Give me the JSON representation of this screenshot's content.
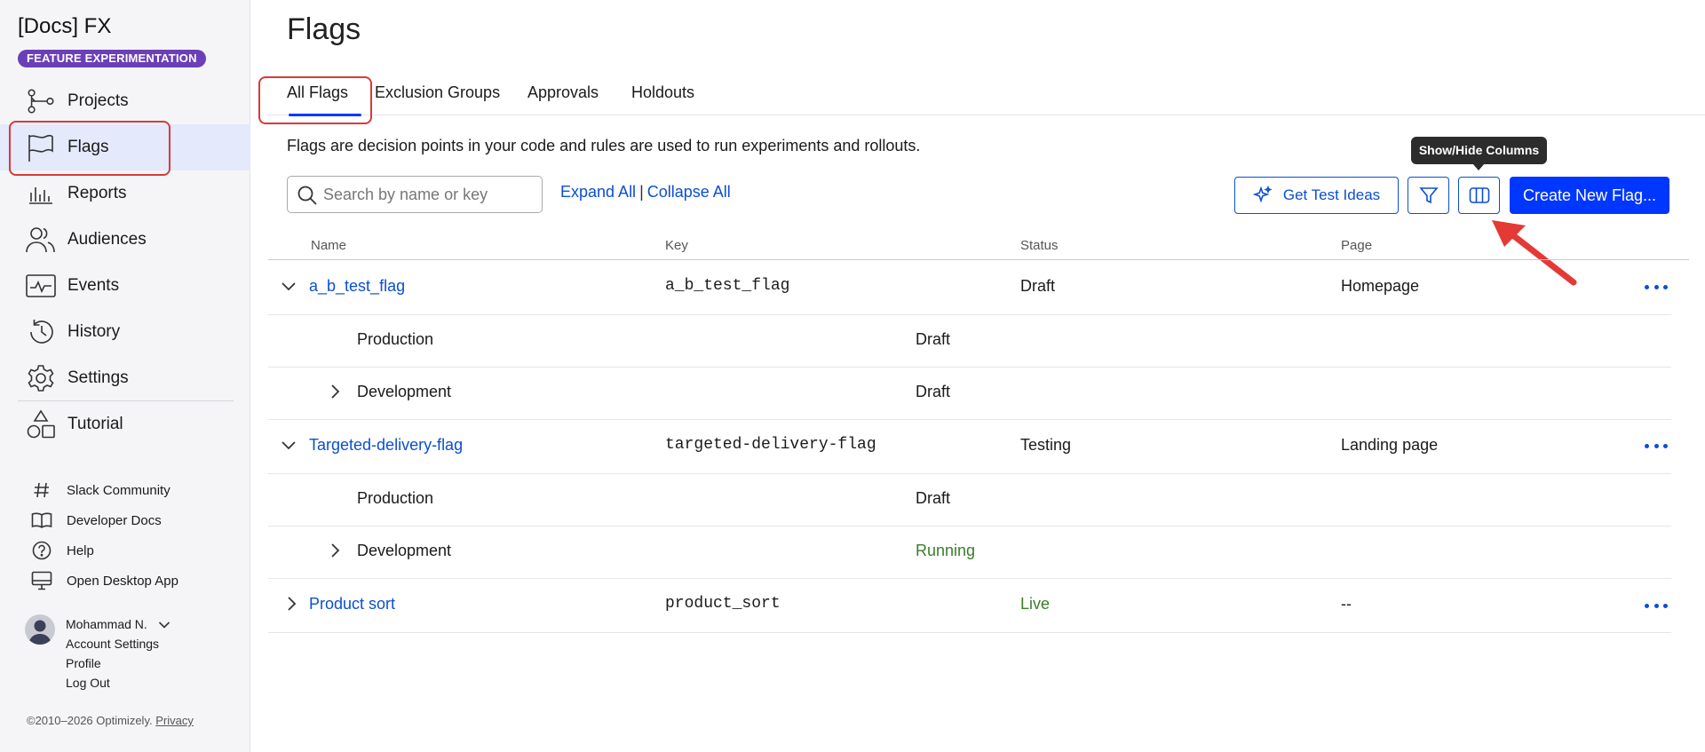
{
  "sidebar": {
    "brand": "[Docs] FX",
    "badge": "FEATURE EXPERIMENTATION",
    "nav": [
      {
        "label": "Projects",
        "icon": "projects-icon"
      },
      {
        "label": "Flags",
        "icon": "flag-icon"
      },
      {
        "label": "Reports",
        "icon": "reports-icon"
      },
      {
        "label": "Audiences",
        "icon": "audiences-icon"
      },
      {
        "label": "Events",
        "icon": "events-icon"
      },
      {
        "label": "History",
        "icon": "history-icon"
      },
      {
        "label": "Settings",
        "icon": "gear-icon"
      },
      {
        "label": "Tutorial",
        "icon": "tutorial-icon"
      }
    ],
    "links": [
      {
        "label": "Slack Community",
        "icon": "hash-icon"
      },
      {
        "label": "Developer Docs",
        "icon": "book-icon"
      },
      {
        "label": "Help",
        "icon": "help-icon"
      },
      {
        "label": "Open Desktop App",
        "icon": "desktop-icon"
      }
    ],
    "user": {
      "name": "Mohammad N.",
      "account_settings": "Account Settings",
      "profile": "Profile",
      "logout": "Log Out"
    },
    "copyright": "©2010–2026 Optimizely.",
    "privacy": "Privacy"
  },
  "main": {
    "title": "Flags",
    "tabs": [
      "All Flags",
      "Exclusion Groups",
      "Approvals",
      "Holdouts"
    ],
    "description": "Flags are decision points in your code and rules are used to run experiments and rollouts.",
    "search": {
      "placeholder": "Search by name or key"
    },
    "expand_all": "Expand All",
    "collapse_all": "Collapse All",
    "get_test_ideas": "Get Test Ideas",
    "create_flag": "Create New Flag...",
    "tooltip": "Show/Hide Columns",
    "columns": [
      "Name",
      "Key",
      "Status",
      "Page"
    ],
    "flags": [
      {
        "name": "a_b_test_flag",
        "key": "a_b_test_flag",
        "status": "Draft",
        "page": "Homepage",
        "environments": [
          {
            "name": "Production",
            "status": "Draft"
          },
          {
            "name": "Development",
            "status": "Draft"
          }
        ]
      },
      {
        "name": "Targeted-delivery-flag",
        "key": "targeted-delivery-flag",
        "status": "Testing",
        "page": "Landing page",
        "environments": [
          {
            "name": "Production",
            "status": "Draft"
          },
          {
            "name": "Development",
            "status": "Running"
          }
        ]
      },
      {
        "name": "Product sort",
        "key": "product_sort",
        "status": "Live",
        "page": "--"
      }
    ]
  },
  "colors": {
    "accent": "#0037ff",
    "link": "#0b4fd1",
    "badge": "#6b3fb8",
    "running": "#3a7d2c",
    "live": "#3a7d2c",
    "highlight_box": "#d83a3a",
    "arrow": "#e53935"
  }
}
